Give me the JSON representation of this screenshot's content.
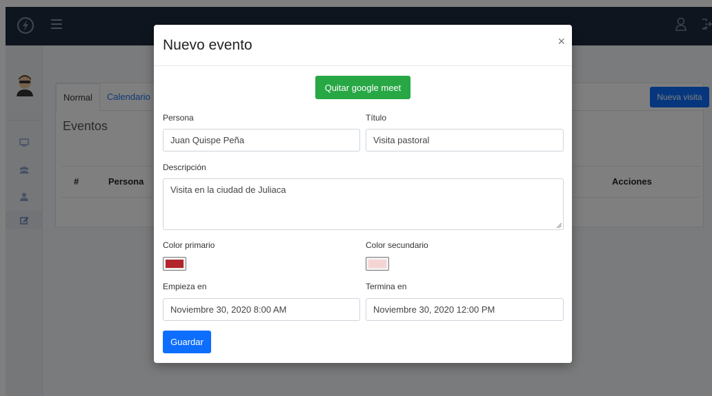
{
  "app": {
    "icons": {
      "brand": "lightning-icon",
      "menu": "hamburger-icon",
      "user": "user-icon",
      "logout": "logout-icon"
    },
    "sidebar": {
      "items": [
        {
          "icon": "monitor-icon"
        },
        {
          "icon": "users-icon"
        },
        {
          "icon": "user-icon"
        },
        {
          "icon": "edit-icon"
        }
      ]
    },
    "tabs": [
      "Normal",
      "Calendario"
    ],
    "section_title": "Eventos",
    "table_headers": {
      "number": "#",
      "person": "Persona",
      "actions": "Acciones"
    },
    "new_visit_label": "Nueva visita",
    "colors": {
      "topbar": "#1f2a3c",
      "primary_blue": "#0d6efd",
      "green": "#28a745"
    }
  },
  "modal": {
    "title": "Nuevo evento",
    "close_label": "×",
    "meet_button": "Quitar google meet",
    "person_label": "Persona",
    "person_value": "Juan Quispe Peña",
    "title_label": "Título",
    "title_value": "Visita pastoral",
    "description_label": "Descripción",
    "description_value": "Visita en la ciudad de Juliaca",
    "primary_color_label": "Color primario",
    "primary_color": "#b3242b",
    "secondary_color_label": "Color secundario",
    "secondary_color": "#f6d4d4",
    "start_label": "Empieza en",
    "start_value": "Noviembre 30, 2020 8:00 AM",
    "end_label": "Termina en",
    "end_value": "Noviembre 30, 2020 12:00 PM",
    "save_button": "Guardar"
  }
}
